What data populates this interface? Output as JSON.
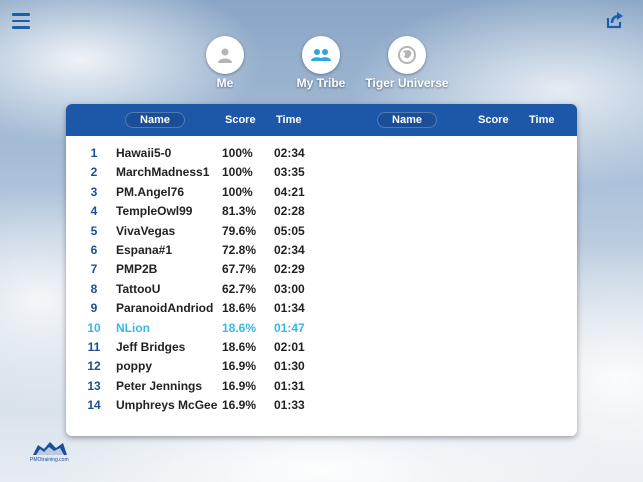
{
  "header": {
    "menu_icon": "hamburger-menu-icon",
    "share_icon": "share-export-icon"
  },
  "tabs": [
    {
      "label": "Me",
      "icon": "person-icon",
      "active": false
    },
    {
      "label": "My Tribe",
      "icon": "group-icon",
      "active": true
    },
    {
      "label": "Tiger Universe",
      "icon": "globe-icon",
      "active": false
    }
  ],
  "leaderboard": {
    "columns_left": {
      "name": "Name",
      "score": "Score",
      "time": "Time"
    },
    "columns_right": {
      "name": "Name",
      "score": "Score",
      "time": "Time"
    },
    "rows": [
      {
        "rank": "1",
        "name": "Hawaii5-0",
        "score": "100%",
        "time": "02:34"
      },
      {
        "rank": "2",
        "name": "MarchMadness1",
        "score": "100%",
        "time": "03:35"
      },
      {
        "rank": "3",
        "name": "PM.Angel76",
        "score": "100%",
        "time": "04:21"
      },
      {
        "rank": "4",
        "name": "TempleOwl99",
        "score": "81.3%",
        "time": "02:28"
      },
      {
        "rank": "5",
        "name": "VivaVegas",
        "score": "79.6%",
        "time": "05:05"
      },
      {
        "rank": "6",
        "name": "Espana#1",
        "score": "72.8%",
        "time": "02:34"
      },
      {
        "rank": "7",
        "name": "PMP2B",
        "score": "67.7%",
        "time": "02:29"
      },
      {
        "rank": "8",
        "name": "TattooU",
        "score": "62.7%",
        "time": "03:00"
      },
      {
        "rank": "9",
        "name": "ParanoidAndriod",
        "score": "18.6%",
        "time": "01:34"
      },
      {
        "rank": "10",
        "name": "NLion",
        "score": "18.6%",
        "time": "01:47"
      },
      {
        "rank": "11",
        "name": "Jeff Bridges",
        "score": "18.6%",
        "time": "02:01"
      },
      {
        "rank": "12",
        "name": "poppy",
        "score": "16.9%",
        "time": "01:30"
      },
      {
        "rank": "13",
        "name": "Peter Jennings",
        "score": "16.9%",
        "time": "01:31"
      },
      {
        "rank": "14",
        "name": "Umphreys McGee",
        "score": "16.9%",
        "time": "01:33"
      }
    ],
    "highlight_rank": "10"
  },
  "footer": {
    "logo_text": "PMOtraining.com"
  },
  "colors": {
    "accent": "#1c57a8",
    "highlight": "#3ab8e4",
    "rank": "#1c4f96"
  }
}
